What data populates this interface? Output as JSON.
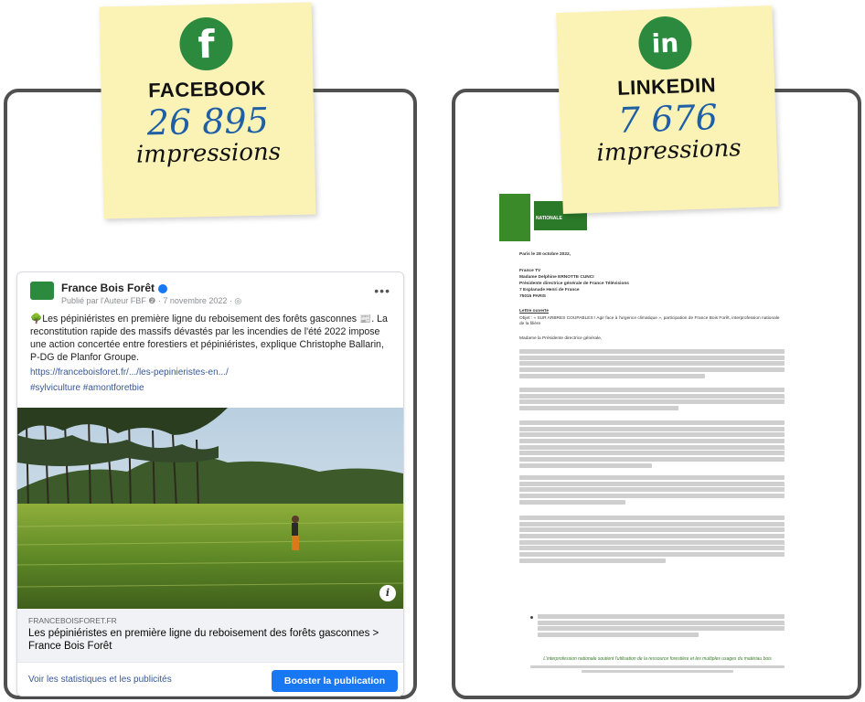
{
  "facebook_note": {
    "icon": "facebook-icon",
    "icon_glyph": "f",
    "network": "FACEBOOK",
    "count": "26 895",
    "unit": "impressions",
    "color": "#2b8a3e"
  },
  "linkedin_note": {
    "icon": "linkedin-icon",
    "icon_glyph": "in",
    "network": "LINKEDIN",
    "count": "7 676",
    "unit": "impressions"
  },
  "fb_post": {
    "page_name": "France Bois Forêt",
    "meta": "Publié par l'Auteur FBF ❷ · 7 novembre 2022 · ◎",
    "more": "•••",
    "body": "🌳Les pépiniéristes en première ligne du reboisement des forêts gasconnes 📰. La reconstitution rapide des massifs dévastés par les incendies de l'été 2022 impose une action concertée entre forestiers et pépiniéristes, explique Christophe Ballarin, P-DG de Planfor Groupe.",
    "link": "https://franceboisforet.fr/.../les-pepinieristes-en.../",
    "tags": "#sylviculture #amontforetbie",
    "card_domain": "FRANCEBOISFORET.FR",
    "card_title": "Les pépiniéristes en première ligne du reboisement des forêts gasconnes > France Bois Forêt",
    "stats_link": "Voir les statistiques et les publicités",
    "boost_button": "Booster la publication",
    "info_glyph": "i"
  },
  "letter": {
    "logo_text": "NATIONALE",
    "date": "Paris le 28 octobre 2022,",
    "recipient": "France TV",
    "recipient_name": "Madame Delphine ERNOTTE CUNCI",
    "recipient_title": "Présidente directrice générale de France Télévisions",
    "recipient_address": "7 Esplanade Henri de France",
    "recipient_city": "75015 PARIS",
    "letter_type": "Lettre ouverte",
    "object": "Objet : « SUR ARBRES COUPABLES ! Agir face à l'urgence climatique », participation de France Bois Forêt, interprofession nationale de la filière",
    "salutation": "Madame la Présidente directrice générale,",
    "footer": "L'interprofession nationale soutient l'utilisation de la ressource forestière et les multiples usages du matériau bois"
  }
}
